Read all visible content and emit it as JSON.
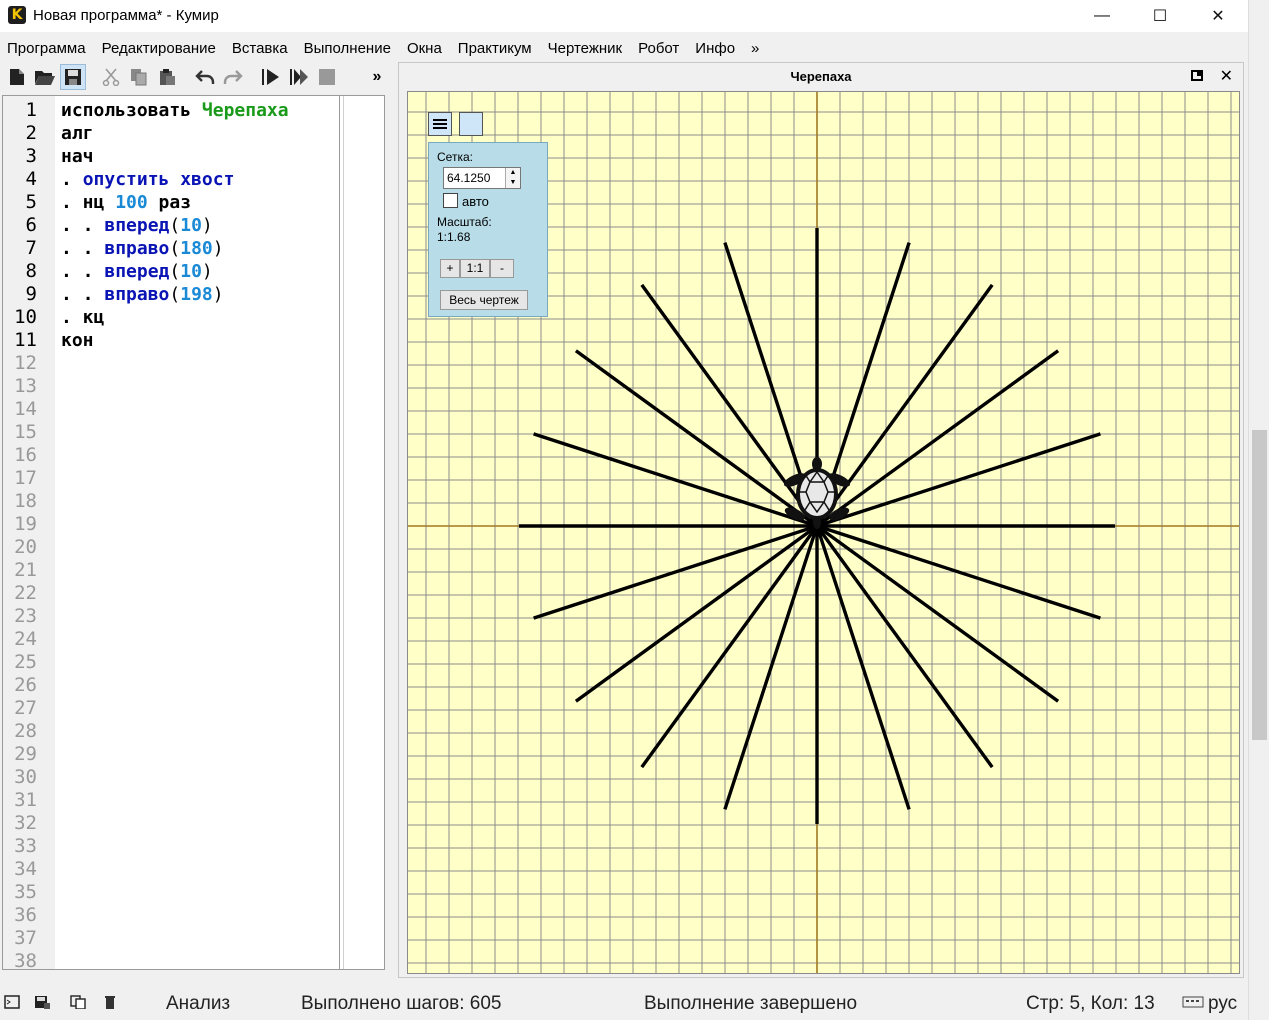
{
  "window": {
    "title": "Новая программа* - Кумир",
    "icon_letter": "K",
    "min_glyph": "—",
    "max_glyph": "☐",
    "close_glyph": "✕"
  },
  "menu": [
    "Программа",
    "Редактирование",
    "Вставка",
    "Выполнение",
    "Окна",
    "Практикум",
    "Чертежник",
    "Робот",
    "Инфо",
    "»"
  ],
  "toolbar": {
    "icons": [
      "new-file-icon",
      "open-folder-icon",
      "save-icon",
      "cut-icon",
      "copy-icon",
      "paste-icon",
      "undo-icon",
      "redo-icon",
      "run-icon",
      "step-run-icon",
      "stop-icon"
    ],
    "more_label": "»"
  },
  "editor": {
    "line_numbers": [
      "1",
      "2",
      "3",
      "4",
      "5",
      "6",
      "7",
      "8",
      "9",
      "10",
      "11",
      "12",
      "13",
      "14",
      "15",
      "16",
      "17",
      "18",
      "19",
      "20",
      "21",
      "22",
      "23",
      "24",
      "25",
      "26",
      "27",
      "28",
      "29",
      "30",
      "31",
      "32",
      "33",
      "34",
      "35",
      "36",
      "37",
      "38"
    ],
    "lines": [
      [
        {
          "t": "использовать ",
          "c": "k"
        },
        {
          "t": "Черепаха",
          "c": "name"
        }
      ],
      [
        {
          "t": "алг",
          "c": "k"
        }
      ],
      [
        {
          "t": "нач",
          "c": "k"
        }
      ],
      [
        {
          "t": ". ",
          "c": "k"
        },
        {
          "t": "опустить хвост",
          "c": "blue"
        }
      ],
      [
        {
          "t": ". нц ",
          "c": "k"
        },
        {
          "t": "100",
          "c": "num"
        },
        {
          "t": " раз",
          "c": "k"
        }
      ],
      [
        {
          "t": ". . ",
          "c": "k"
        },
        {
          "t": "вперед",
          "c": "blue"
        },
        {
          "t": "(",
          "c": "par"
        },
        {
          "t": "10",
          "c": "num"
        },
        {
          "t": ")",
          "c": "par"
        }
      ],
      [
        {
          "t": ". . ",
          "c": "k"
        },
        {
          "t": "вправо",
          "c": "blue"
        },
        {
          "t": "(",
          "c": "par"
        },
        {
          "t": "180",
          "c": "num"
        },
        {
          "t": ")",
          "c": "par"
        }
      ],
      [
        {
          "t": ". . ",
          "c": "k"
        },
        {
          "t": "вперед",
          "c": "blue"
        },
        {
          "t": "(",
          "c": "par"
        },
        {
          "t": "10",
          "c": "num"
        },
        {
          "t": ")",
          "c": "par"
        }
      ],
      [
        {
          "t": ". . ",
          "c": "k"
        },
        {
          "t": "вправо",
          "c": "blue"
        },
        {
          "t": "(",
          "c": "par"
        },
        {
          "t": "198",
          "c": "num"
        },
        {
          "t": ")",
          "c": "par"
        }
      ],
      [
        {
          "t": ". кц",
          "c": "k"
        }
      ],
      [
        {
          "t": "кон",
          "c": "k"
        }
      ]
    ]
  },
  "turtle_window": {
    "title": "Черепаха",
    "close_glyph": "✕",
    "grid_panel": {
      "grid_label": "Сетка:",
      "grid_value": "64.1250",
      "auto_label": "авто",
      "auto_checked": false,
      "scale_label": "Масштаб:",
      "scale_value": "1:1.68",
      "zoom_in": "+",
      "zoom_reset": "1:1",
      "zoom_out": "-",
      "fit_all": "Весь чертеж"
    },
    "drawing": {
      "rays": 20,
      "segment_length": 10,
      "turn_angle": 198
    },
    "colors": {
      "background": "#ffffc8",
      "grid": "#8c8c8c",
      "axes": "#a07820",
      "lines": "#000000"
    }
  },
  "statusbar": {
    "analysis": "Анализ",
    "steps": "Выполнено шагов: 605",
    "state": "Выполнение завершено",
    "position": "Стр: 5, Кол: 13",
    "language": "рус"
  }
}
